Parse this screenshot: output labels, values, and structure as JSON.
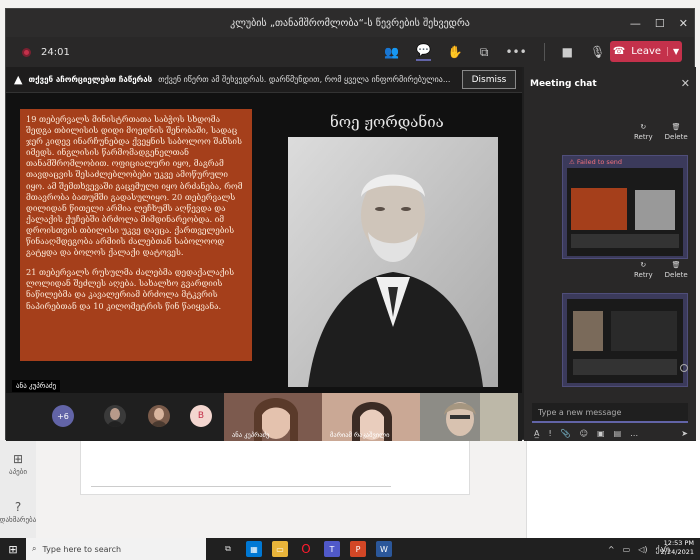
{
  "window": {
    "title": "კლუბის „თანამშრომლობა“-ს წევრების შეხვედრა",
    "timer": "24:01",
    "leave_label": "Leave"
  },
  "notification": {
    "bold_text": "თქვენ აჩორციელებთ ჩაწერას",
    "text": "თქვენ იწერთ ამ შეხვედრას. დარწმუნდით, რომ ყველა ინფორმირებულია...",
    "dismiss_label": "Dismiss"
  },
  "slide": {
    "title": "ნოე ჟორდანია",
    "paragraphs": [
      "19 თებერვალს მინისტრთათა საბჭოს სხდომა შედგა თბილისის დიდი მოედნის შენობაში, სადაც ჯერ კიდევ ინარჩუნებდა ქვეყნის საბოლოო შანსის იმედს. ინგლისის წარმომადგენელთან თანამშრომლობით. ოფიციალური იყო, მაგრამ თავდაცვის შესაძლებლობები უკვე ამოწურული იყო. ამ შემთხვევაში გაცემული იყო ბრძანება, რომ მთავრობა ბათუმში გადასულიყო. 20 თებერვალს დილიდან წითელი არმია ლეჩხუმს აღწევდა და ქალაქის ქუჩებში ბრძოლა მიმდინარეობდა. იმ დროისთვის თბილისი უკვე დაეცა. ქართველების წინააღმდეგობა არმიის ძალებთან საბოლოოდ გატყდა და ბოლოს ქალაქი დატოვეს.",
      "21 თებერვალს რუსულმა ძალებმა დედაქალაქის ლოლიდან შეძლეს აღება. სახალხო გვარდიის ნაწილებმა და კავალერიამ ბრძოლა მტკვრის ნაპირებთან და 10 კილომეტრის წინ წაიყვანა."
    ],
    "presenter_tag": "ანა კუპრაძე"
  },
  "gallery": {
    "overflow_count": "+6",
    "avatar_initial": "B",
    "tiles": [
      {
        "name": "ანა კუპრაძე"
      },
      {
        "name": "მარიამ რაკაშვილი"
      },
      {
        "name": ""
      }
    ]
  },
  "chat": {
    "title": "Meeting chat",
    "retry_label": "Retry",
    "delete_label": "Delete",
    "failed_label": "Failed to send",
    "compose_placeholder": "Type a new message"
  },
  "taskbar": {
    "search_placeholder": "Type here to search",
    "time": "12:53 PM",
    "date": "2/24/2021",
    "lang": "ქარ"
  },
  "background_app": {
    "left_items": [
      {
        "label": "აპები"
      },
      {
        "label": "დახმარება"
      }
    ]
  },
  "colors": {
    "accent": "#6264a7",
    "leave": "#c4314b",
    "slide_panel": "#a53f1b"
  }
}
